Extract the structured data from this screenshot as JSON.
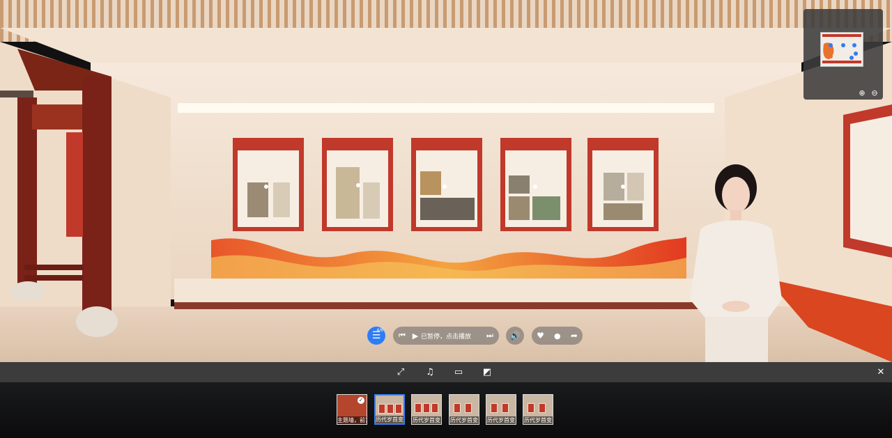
{
  "player": {
    "playlist_count": "4/6",
    "status_text": "已暂停，点击播放"
  },
  "thumbnails": [
    {
      "label": "主题墙，前言",
      "active": false,
      "checked": true
    },
    {
      "label": "历代岁首变",
      "active": true,
      "checked": false
    },
    {
      "label": "历代岁首变",
      "active": false,
      "checked": false
    },
    {
      "label": "历代岁首变",
      "active": false,
      "checked": false
    },
    {
      "label": "历代岁首变",
      "active": false,
      "checked": false
    },
    {
      "label": "历代岁首变",
      "active": false,
      "checked": false
    }
  ],
  "icons": {
    "playlist": "playlist-icon",
    "prev": "skip-previous-icon",
    "play": "play-icon",
    "next": "skip-next-icon",
    "volume": "volume-icon",
    "like": "heart-icon",
    "comment": "comment-icon",
    "share": "share-icon",
    "fullscreen": "fullscreen-icon",
    "music": "music-icon",
    "vr": "vr-glasses-icon",
    "gyro": "gyroscope-icon",
    "close": "close-icon",
    "zoom_in": "zoom-in-icon",
    "zoom_out": "zoom-out-icon"
  },
  "colors": {
    "accent": "#2f7df6",
    "panel_red": "#c0392b",
    "toolbar_bg": "#3c3c3c"
  }
}
